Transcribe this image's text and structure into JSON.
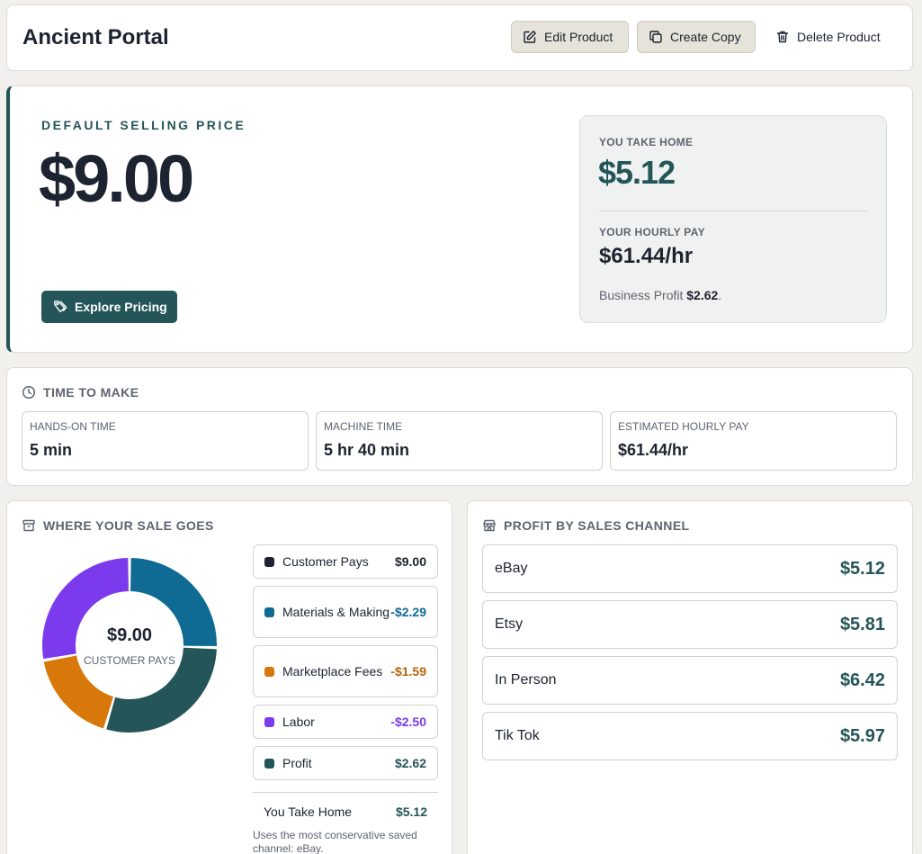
{
  "header": {
    "title": "Ancient Portal",
    "edit_label": "Edit Product",
    "copy_label": "Create Copy",
    "delete_label": "Delete Product"
  },
  "pricing": {
    "label": "DEFAULT SELLING PRICE",
    "price": "$9.00",
    "explore_label": "Explore Pricing",
    "take_home_label": "YOU TAKE HOME",
    "take_home_value": "$5.12",
    "hourly_label": "YOUR HOURLY PAY",
    "hourly_value": "$61.44/hr",
    "business_profit_prefix": "Business Profit",
    "business_profit_value": "$2.62",
    "business_profit_suffix": "."
  },
  "time": {
    "heading": "TIME TO MAKE",
    "boxes": [
      {
        "label": "HANDS-ON TIME",
        "value": "5 min"
      },
      {
        "label": "MACHINE TIME",
        "value": "5 hr 40 min"
      },
      {
        "label": "ESTIMATED HOURLY PAY",
        "value": "$61.44/hr"
      }
    ]
  },
  "sale": {
    "heading": "WHERE YOUR SALE GOES",
    "donut_total": "$9.00",
    "donut_sub": "CUSTOMER PAYS",
    "items": [
      {
        "name": "Customer Pays",
        "amount": "$9.00",
        "color": "#1d2330",
        "amount_color": "#1d2330"
      },
      {
        "name": "Materials & Making",
        "amount": "-$2.29",
        "color": "#0f6a94",
        "amount_color": "#0f6a94"
      },
      {
        "name": "Marketplace Fees",
        "amount": "-$1.59",
        "color": "#d9780a",
        "amount_color": "#b5650b"
      },
      {
        "name": "Labor",
        "amount": "-$2.50",
        "color": "#7c3aed",
        "amount_color": "#7c3aed"
      },
      {
        "name": "Profit",
        "amount": "$2.62",
        "color": "#245559",
        "amount_color": "#245559"
      }
    ],
    "take_home_label": "You Take Home",
    "take_home_value": "$5.12",
    "note": "Uses the most conservative saved channel: eBay."
  },
  "channels": {
    "heading": "PROFIT BY SALES CHANNEL",
    "rows": [
      {
        "name": "eBay",
        "value": "$5.12"
      },
      {
        "name": "Etsy",
        "value": "$5.81"
      },
      {
        "name": "In Person",
        "value": "$6.42"
      },
      {
        "name": "Tik Tok",
        "value": "$5.97"
      }
    ]
  },
  "chart_data": {
    "type": "pie",
    "categories": [
      "Materials & Making",
      "Profit",
      "Marketplace Fees",
      "Labor"
    ],
    "values": [
      2.29,
      2.62,
      1.59,
      2.5
    ],
    "colors": [
      "#0f6a94",
      "#245559",
      "#d9780a",
      "#7c3aed"
    ],
    "center_value": "$9.00",
    "center_label": "CUSTOMER PAYS"
  }
}
